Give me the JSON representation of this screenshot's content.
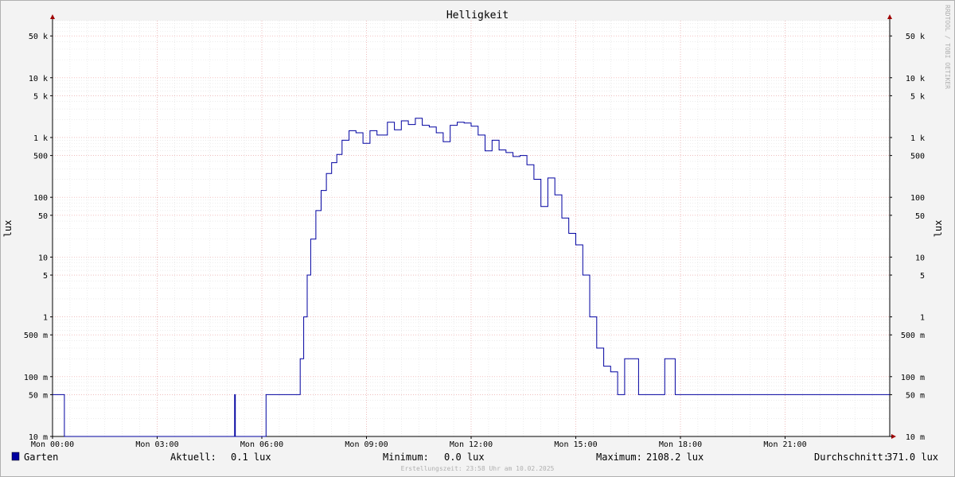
{
  "chart_data": {
    "type": "line",
    "title": "Helligkeit",
    "ylabel": "lux",
    "y_scale": "log",
    "ylim": [
      0.01,
      90000
    ],
    "xlim_hours": [
      0,
      24
    ],
    "x_tick_labels": [
      "Mon 00:00",
      "Mon 03:00",
      "Mon 06:00",
      "Mon 09:00",
      "Mon 12:00",
      "Mon 15:00",
      "Mon 18:00",
      "Mon 21:00"
    ],
    "x_tick_hours": [
      0,
      3,
      6,
      9,
      12,
      15,
      18,
      21
    ],
    "y_ticks": [
      {
        "value": 0.01,
        "label": "10 m"
      },
      {
        "value": 0.05,
        "label": "50 m"
      },
      {
        "value": 0.1,
        "label": "100 m"
      },
      {
        "value": 0.5,
        "label": "500 m"
      },
      {
        "value": 1,
        "label": "1"
      },
      {
        "value": 5,
        "label": "5"
      },
      {
        "value": 10,
        "label": "10"
      },
      {
        "value": 50,
        "label": "50"
      },
      {
        "value": 100,
        "label": "100"
      },
      {
        "value": 500,
        "label": "500"
      },
      {
        "value": 1000,
        "label": "1 k"
      },
      {
        "value": 5000,
        "label": "5 k"
      },
      {
        "value": 10000,
        "label": "10 k"
      },
      {
        "value": 50000,
        "label": "50 k"
      }
    ],
    "grid": true,
    "legend_position": "bottom-left",
    "series": [
      {
        "name": "Garten",
        "color": "#0000a0",
        "hours": [
          0,
          0.33,
          0.34,
          5.2,
          5.22,
          5.24,
          6.1,
          6.12,
          7.0,
          7.1,
          7.2,
          7.3,
          7.4,
          7.55,
          7.7,
          7.85,
          8.0,
          8.15,
          8.3,
          8.5,
          8.7,
          8.9,
          9.1,
          9.3,
          9.6,
          9.8,
          10.0,
          10.2,
          10.4,
          10.6,
          10.8,
          11.0,
          11.2,
          11.4,
          11.6,
          11.8,
          12.0,
          12.2,
          12.4,
          12.6,
          12.8,
          13.0,
          13.2,
          13.4,
          13.6,
          13.8,
          14.0,
          14.2,
          14.4,
          14.6,
          14.8,
          15.0,
          15.2,
          15.4,
          15.6,
          15.8,
          16.0,
          16.2,
          16.4,
          16.6,
          16.8,
          17.0,
          17.2,
          17.4,
          17.55,
          17.7,
          17.85,
          17.95,
          18.0,
          18.05,
          18.1,
          18.15,
          18.2,
          18.25,
          18.3,
          18.45,
          18.5,
          18.55,
          18.6,
          18.7,
          19.0,
          19.05,
          19.2,
          19.25,
          19.3,
          24
        ],
        "values": [
          0.05,
          0.05,
          0.01,
          0.01,
          0.05,
          0.01,
          0.01,
          0.05,
          0.05,
          0.2,
          1,
          5,
          20,
          60,
          130,
          250,
          380,
          520,
          900,
          1300,
          1200,
          800,
          1300,
          1100,
          1800,
          1350,
          1900,
          1650,
          2100,
          1600,
          1500,
          1200,
          850,
          1600,
          1800,
          1750,
          1550,
          1100,
          600,
          900,
          620,
          560,
          480,
          500,
          350,
          200,
          70,
          210,
          110,
          45,
          25,
          16,
          5,
          1,
          0.3,
          0.15,
          0.12,
          0.05,
          0.2,
          0.2,
          0.05,
          0.05,
          0.05,
          0.05,
          0.2,
          0.2,
          0.05,
          0.05,
          0.05,
          0.05,
          0.05,
          0.05,
          0.05,
          0.05,
          0.05,
          0.05,
          0.05,
          0.05,
          0.05,
          0.05,
          0.05,
          0.05,
          0.05,
          0.05,
          0.05,
          0.05
        ]
      }
    ],
    "stats": {
      "current_label": "Aktuell:",
      "current_value": "0.1 lux",
      "min_label": "Minimum:",
      "min_value": "0.0 lux",
      "max_label": "Maximum:",
      "max_value": "2108.2 lux",
      "avg_label": "Durchschnitt:",
      "avg_value": "371.0 lux"
    },
    "footer": "Erstellungszeit: 23:58 Uhr am 10.02.2025",
    "watermark": "RRDTOOL / TOBI OETIKER"
  }
}
